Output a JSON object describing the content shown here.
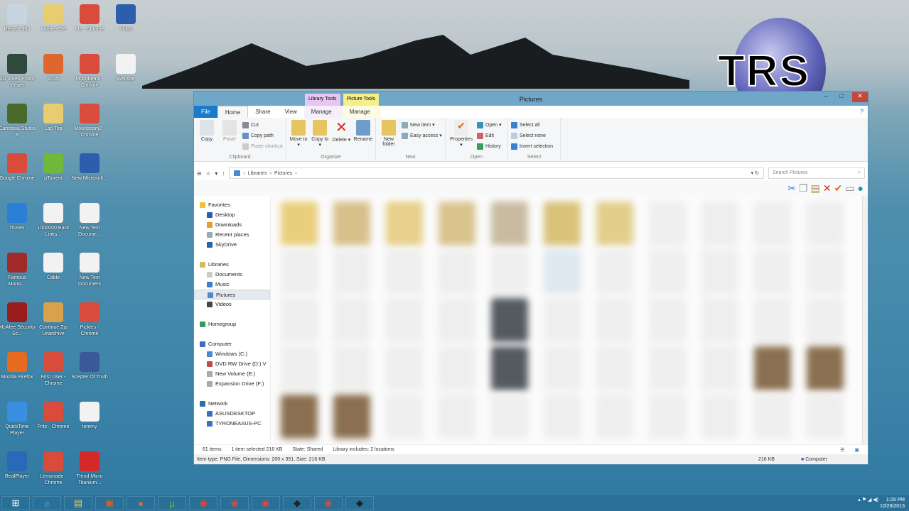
{
  "desktop_icons": [
    {
      "label": "Recycle Bin",
      "color": "#c8d4e0"
    },
    {
      "label": "Adobe CS6",
      "color": "#e8cd70"
    },
    {
      "label": "Me - Chrome",
      "color": "#d94b3b"
    },
    {
      "label": "Video",
      "color": "#2b5fad"
    },
    {
      "label": "3D Video Photo Viewer",
      "color": "#2f4a3c"
    },
    {
      "label": "2015",
      "color": "#e0662f"
    },
    {
      "label": "Moonbeam - Chrome",
      "color": "#d94b3b"
    },
    {
      "label": "Website",
      "color": "#f2f2f2"
    },
    {
      "label": "Camtasia Studio 8",
      "color": "#4a6a2c"
    },
    {
      "label": "Lap Top",
      "color": "#e8cd70"
    },
    {
      "label": "Moonbeam2 - Chrome",
      "color": "#d94b3b"
    },
    {
      "label": "",
      "color": ""
    },
    {
      "label": "Google Chrome",
      "color": "#d94b3b"
    },
    {
      "label": "µTorrent",
      "color": "#6fb83a"
    },
    {
      "label": "New Microsoft...",
      "color": "#2b5fad"
    },
    {
      "label": "",
      "color": ""
    },
    {
      "label": "iTunes",
      "color": "#2a7fd6"
    },
    {
      "label": "1000000 Back Links...",
      "color": "#f2f2f2"
    },
    {
      "label": "New Text Docume...",
      "color": "#f2f2f2"
    },
    {
      "label": "",
      "color": ""
    },
    {
      "label": "Famous Monst...",
      "color": "#a02a2a"
    },
    {
      "label": "Cable",
      "color": "#f2f2f2"
    },
    {
      "label": "New Text Document",
      "color": "#f2f2f2"
    },
    {
      "label": "",
      "color": ""
    },
    {
      "label": "McAfee Security Sc...",
      "color": "#9b1c1c"
    },
    {
      "label": "Continue Zip Unarchive",
      "color": "#d9a24a"
    },
    {
      "label": "Pickles - Chrome",
      "color": "#d94b3b"
    },
    {
      "label": "",
      "color": ""
    },
    {
      "label": "Mozilla Firefox",
      "color": "#e86a1f"
    },
    {
      "label": "First User - Chrome",
      "color": "#d94b3b"
    },
    {
      "label": "Scepter Of Truth",
      "color": "#3b5998"
    },
    {
      "label": "",
      "color": ""
    },
    {
      "label": "QuickTime Player",
      "color": "#3a8fe0"
    },
    {
      "label": "Fritz - Chrome",
      "color": "#d94b3b"
    },
    {
      "label": "tommy",
      "color": "#f2f2f2"
    },
    {
      "label": "",
      "color": ""
    },
    {
      "label": "RealPlayer",
      "color": "#2a68b8"
    },
    {
      "label": "Lemonade - Chrome",
      "color": "#d94b3b"
    },
    {
      "label": "Trend Micro Titanium...",
      "color": "#d62828"
    },
    {
      "label": "",
      "color": ""
    }
  ],
  "logo": {
    "text": "TRS"
  },
  "window": {
    "title": "Pictures",
    "context_tabs": [
      {
        "label": "Library Tools",
        "color": "#e7c6ef"
      },
      {
        "label": "Picture Tools",
        "color": "#f4ef8a"
      }
    ],
    "tabs": [
      "File",
      "Home",
      "Share",
      "View",
      "Manage",
      "Manage"
    ],
    "ribbon": {
      "clipboard": {
        "label": "Clipboard",
        "copy": "Copy",
        "paste": "Paste",
        "cut": "Cut",
        "copy_path": "Copy path",
        "paste_shortcut": "Paste shortcut"
      },
      "organize": {
        "label": "Organize",
        "move_to": "Move to ▾",
        "copy_to": "Copy to ▾",
        "delete": "Delete ▾",
        "rename": "Rename"
      },
      "new": {
        "label": "New",
        "new_folder": "New folder",
        "new_item": "New item ▾",
        "easy_access": "Easy access ▾"
      },
      "open": {
        "label": "Open",
        "properties": "Properties ▾",
        "open": "Open ▾",
        "edit": "Edit",
        "history": "History"
      },
      "select": {
        "label": "Select",
        "select_all": "Select all",
        "select_none": "Select none",
        "invert": "Invert selection"
      }
    },
    "address": {
      "crumbs": [
        "Libraries",
        "Pictures"
      ],
      "search_placeholder": "Search Pictures"
    },
    "nav": [
      {
        "label": "Favorites",
        "indent": 0,
        "color": "#f2c230"
      },
      {
        "label": "Desktop",
        "indent": 1,
        "color": "#2a5db0"
      },
      {
        "label": "Downloads",
        "indent": 1,
        "color": "#e0a030"
      },
      {
        "label": "Recent places",
        "indent": 1,
        "color": "#9aa"
      },
      {
        "label": "SkyDrive",
        "indent": 1,
        "color": "#2a5db0"
      },
      {
        "label": "",
        "indent": 0,
        "color": ""
      },
      {
        "label": "Libraries",
        "indent": 0,
        "color": "#d9b860"
      },
      {
        "label": "Documents",
        "indent": 1,
        "color": "#ccc"
      },
      {
        "label": "Music",
        "indent": 1,
        "color": "#3a7fd0"
      },
      {
        "label": "Pictures",
        "indent": 1,
        "color": "#4a8ad0",
        "selected": true
      },
      {
        "label": "Videos",
        "indent": 1,
        "color": "#445"
      },
      {
        "label": "",
        "indent": 0,
        "color": ""
      },
      {
        "label": "Homegroup",
        "indent": 0,
        "color": "#3a9a5a"
      },
      {
        "label": "",
        "indent": 0,
        "color": ""
      },
      {
        "label": "Computer",
        "indent": 0,
        "color": "#3a6fc0"
      },
      {
        "label": "Windows (C:)",
        "indent": 1,
        "color": "#4a8ad0"
      },
      {
        "label": "DVD RW Drive (D:) V",
        "indent": 1,
        "color": "#c04a4a"
      },
      {
        "label": "New Volume (E:)",
        "indent": 1,
        "color": "#aaa"
      },
      {
        "label": "Expansion Drive (F:)",
        "indent": 1,
        "color": "#aaa"
      },
      {
        "label": "",
        "indent": 0,
        "color": ""
      },
      {
        "label": "Network",
        "indent": 0,
        "color": "#2a6fb0"
      },
      {
        "label": "ASUSDESKTOP",
        "indent": 1,
        "color": "#3a6fc0"
      },
      {
        "label": "TYRONEASUS-PC",
        "indent": 1,
        "color": "#3a6fc0"
      }
    ],
    "status": {
      "items": "61 items",
      "selected": "1 item selected  216 KB",
      "state": "State:  Shared",
      "library": "Library includes: 2 locations"
    },
    "details": {
      "info": "Item type: PNG File, Dimensions: 200 x 351, Size: 216 KB",
      "size": "216 KB",
      "location": "Computer"
    }
  },
  "taskbar": {
    "apps": [
      "start",
      "ie",
      "explorer",
      "app",
      "firefox",
      "utorrent",
      "chrome",
      "chrome",
      "chrome",
      "camtasia",
      "chrome",
      "camtasia"
    ],
    "time": "1:29 PM",
    "date": "10/28/2013"
  }
}
